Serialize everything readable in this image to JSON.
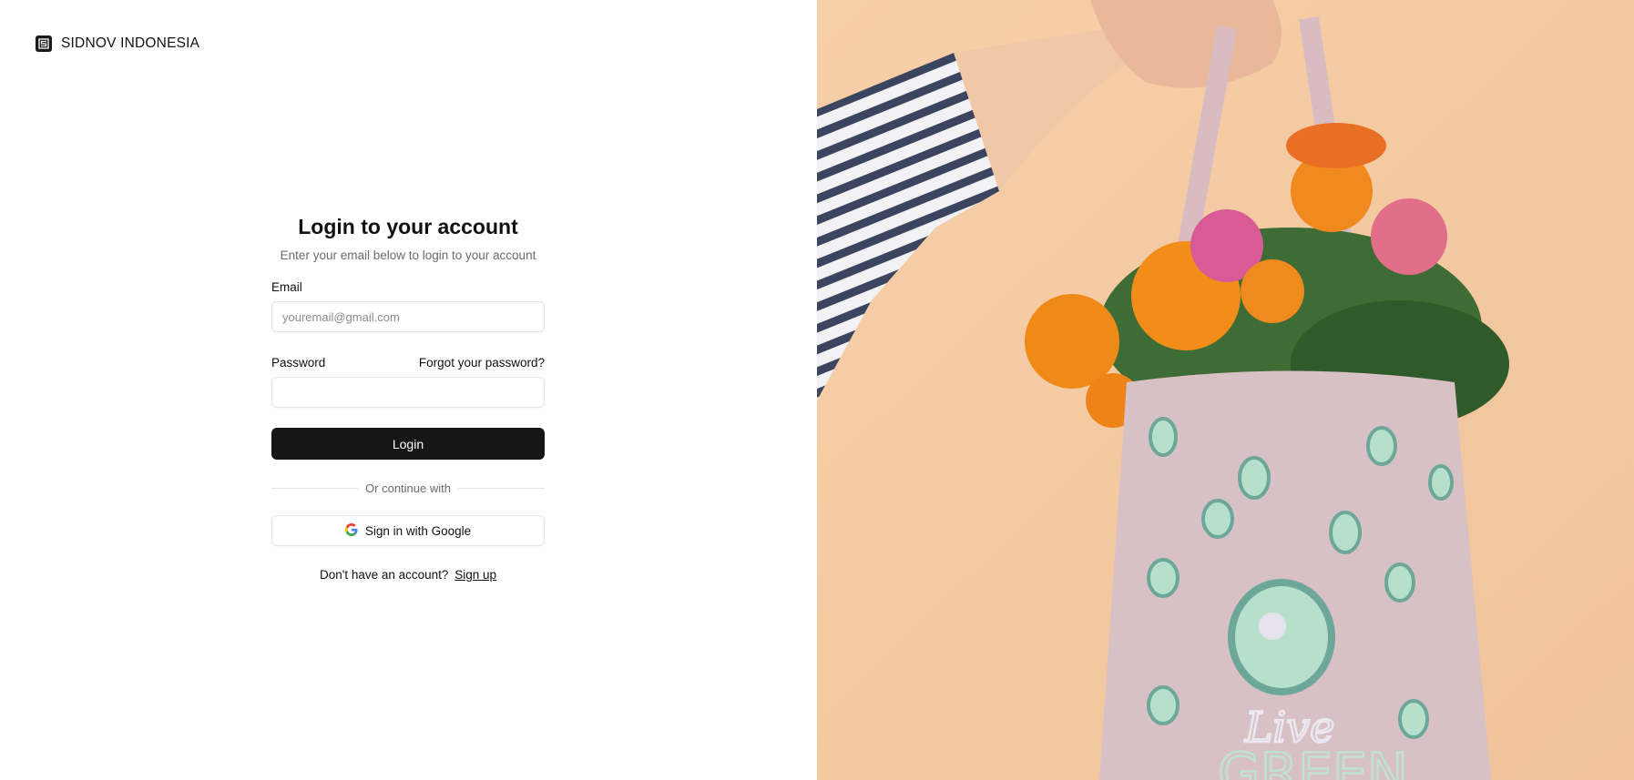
{
  "brand": {
    "name": "SIDNOV INDONESIA",
    "icon": "logo-icon"
  },
  "login": {
    "title": "Login to your account",
    "subtitle": "Enter your email below to login to your account",
    "email_label": "Email",
    "email_placeholder": "youremail@gmail.com",
    "email_value": "",
    "password_label": "Password",
    "forgot_password": "Forgot your password?",
    "password_value": "",
    "login_button": "Login",
    "divider_text": "Or continue with",
    "google_button": "Sign in with Google",
    "signup_prompt": "Don't have an account?",
    "signup_link": "Sign up"
  },
  "colors": {
    "primary_button": "#161616",
    "background": "#ffffff",
    "photo_wall": "#f4c9a3"
  },
  "photo": {
    "icon": "hero-photo"
  }
}
